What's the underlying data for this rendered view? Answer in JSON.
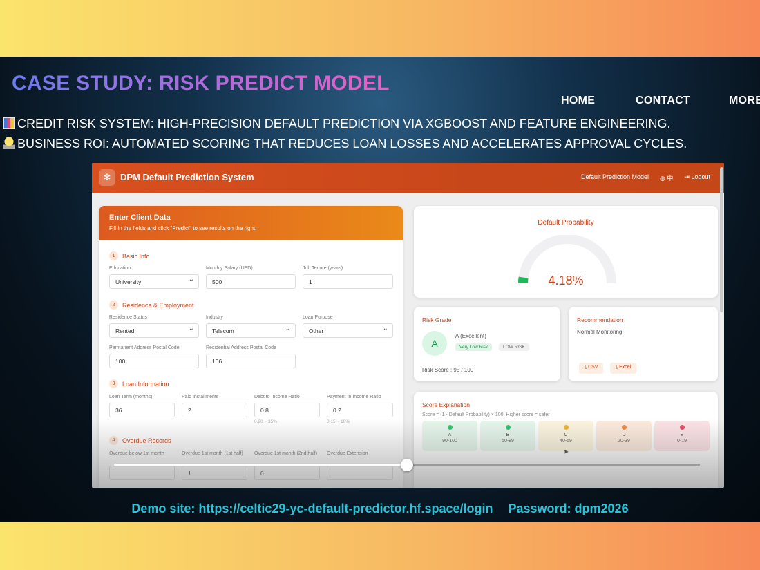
{
  "hero": {
    "title": "CASE STUDY: RISK PREDICT MODEL",
    "nav": [
      "HOME",
      "CONTACT",
      "MORE"
    ],
    "lines": [
      {
        "icon": "bar-chart-icon",
        "text": "CREDIT RISK SYSTEM: HIGH-PRECISION DEFAULT PREDICTION VIA XGBOOST AND FEATURE ENGINEERING."
      },
      {
        "icon": "lightbulb-icon",
        "text": "BUSINESS ROI: AUTOMATED SCORING THAT REDUCES LOAN LOSSES AND ACCELERATES APPROVAL CYCLES."
      }
    ],
    "footer": {
      "demo": "Demo site: https://celtic29-yc-default-predictor.hf.space/login",
      "password": "Password: dpm2026"
    }
  },
  "app": {
    "title": "DPM Default Prediction System",
    "model_label": "Default Prediction Model",
    "lang_label": "中",
    "logout_label": "Logout",
    "form": {
      "title": "Enter Client Data",
      "subtitle": "Fill in the fields and click \"Predict\" to see results on the right.",
      "sections": [
        {
          "num": "1",
          "title": "Basic Info"
        },
        {
          "num": "2",
          "title": "Residence & Employment"
        },
        {
          "num": "3",
          "title": "Loan Information"
        },
        {
          "num": "4",
          "title": "Overdue Records"
        }
      ],
      "fields": {
        "education": {
          "label": "Education",
          "value": "University"
        },
        "salary": {
          "label": "Monthly Salary (USD)",
          "value": "500"
        },
        "tenure": {
          "label": "Job Tenure (years)",
          "value": "1"
        },
        "residence": {
          "label": "Residence Status",
          "value": "Rented"
        },
        "industry": {
          "label": "Industry",
          "value": "Telecom"
        },
        "purpose": {
          "label": "Loan Purpose",
          "value": "Other"
        },
        "perm_postal": {
          "label": "Permanent Address Postal Code",
          "value": "100"
        },
        "res_postal": {
          "label": "Residential Address Postal Code",
          "value": "106"
        },
        "loan_term": {
          "label": "Loan Term (months)",
          "value": "36"
        },
        "paid_inst": {
          "label": "Paid Installments",
          "value": "2"
        },
        "dti": {
          "label": "Debt to Income Ratio",
          "value": "0.8",
          "hint": "0.20 ~ 35%"
        },
        "pti": {
          "label": "Payment to Income Ratio",
          "value": "0.2",
          "hint": "0.15 ~ 10%"
        },
        "od_below": {
          "label": "Overdue below 1st month",
          "value": ""
        },
        "od_1st": {
          "label": "Overdue 1st month (1st half)",
          "value": "1"
        },
        "od_2nd": {
          "label": "Overdue 1st month (2nd half)",
          "value": "0"
        },
        "od_ext": {
          "label": "Overdue Extension",
          "value": ""
        }
      }
    },
    "probability": {
      "title": "Default Probability",
      "value": "4.18%",
      "fraction": 0.0418
    },
    "grade": {
      "title": "Risk Grade",
      "letter": "A",
      "label": "A (Excellent)",
      "badge1": "Very Low Risk",
      "badge2": "LOW RISK",
      "score": "Risk Score : 95 / 100"
    },
    "recommendation": {
      "title": "Recommendation",
      "text": "Normal Monitoring",
      "csv": "CSV",
      "excel": "Excel"
    },
    "explanation": {
      "title": "Score Explanation",
      "formula": "Score = (1 - Default Probability) × 100. Higher score = safer",
      "tiers": [
        {
          "letter": "A",
          "range": "90-100",
          "color": "#2ec46c",
          "bg": "#e6f7ec"
        },
        {
          "letter": "B",
          "range": "60-89",
          "color": "#2ec46c",
          "bg": "#e6f7ec"
        },
        {
          "letter": "C",
          "range": "40-59",
          "color": "#f0b429",
          "bg": "#fdf5df"
        },
        {
          "letter": "D",
          "range": "20-39",
          "color": "#f08a3c",
          "bg": "#fdebdd"
        },
        {
          "letter": "E",
          "range": "0-19",
          "color": "#e84c64",
          "bg": "#fde3e6"
        }
      ]
    },
    "playback": {
      "progress": 0.5
    }
  },
  "colors": {
    "accent": "#c2441a",
    "footer": "#2ec2d8"
  }
}
